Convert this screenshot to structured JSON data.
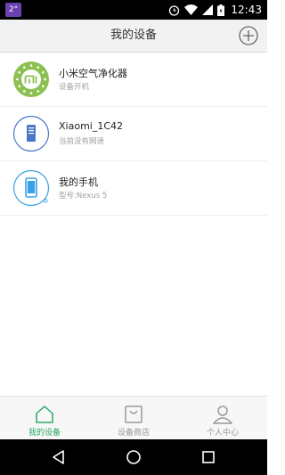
{
  "status_bar": {
    "left_badge": "2°",
    "time": "12:43",
    "icons": [
      "alarm-icon",
      "wifi-icon",
      "signal-icon",
      "battery-icon"
    ]
  },
  "header": {
    "title": "我的设备",
    "add_icon": "plus-circle-icon"
  },
  "devices": [
    {
      "name": "小米空气净化器",
      "status": "设备开机",
      "icon": "mi-air-purifier-icon"
    },
    {
      "name": "Xiaomi_1C42",
      "status": "当前没有网速",
      "icon": "router-icon"
    },
    {
      "name": "我的手机",
      "status": "型号:Nexus 5",
      "icon": "phone-icon"
    }
  ],
  "tabs": [
    {
      "label": "我的设备",
      "icon": "home-icon",
      "active": true
    },
    {
      "label": "设备商店",
      "icon": "store-bag-icon",
      "active": false
    },
    {
      "label": "个人中心",
      "icon": "person-icon",
      "active": false
    }
  ],
  "colors": {
    "accent": "#2aa868",
    "purifier_green": "#8cc152",
    "router_blue": "#4a78c8",
    "phone_blue": "#39a0e6"
  },
  "nav": [
    "back-icon",
    "home-circle-icon",
    "recents-icon"
  ]
}
